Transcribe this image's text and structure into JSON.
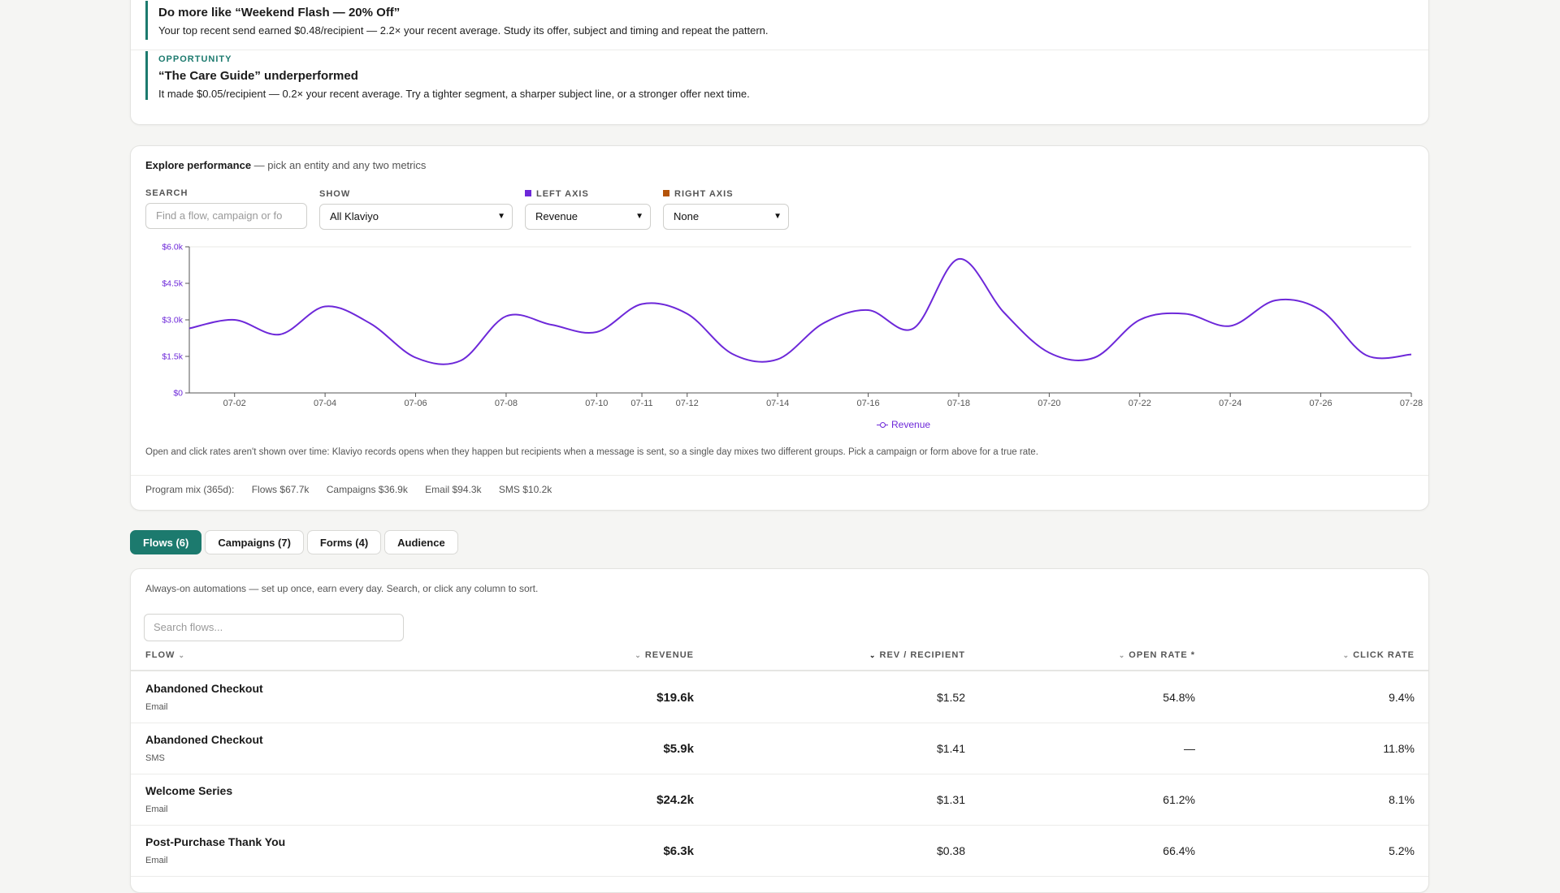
{
  "insights": [
    {
      "kicker": "",
      "title": "Do more like “Weekend Flash — 20% Off”",
      "body": "Your top recent send earned $0.48/recipient — 2.2× your recent average. Study its offer, subject and timing and repeat the pattern."
    },
    {
      "kicker": "OPPORTUNITY",
      "title": "“The Care Guide” underperformed",
      "body": "It made $0.05/recipient — 0.2× your recent average. Try a tighter segment, a sharper subject line, or a stronger offer next time."
    }
  ],
  "explore": {
    "title": "Explore performance",
    "subtitle": "— pick an entity and any two metrics",
    "search_label": "SEARCH",
    "search_placeholder": "Find a flow, campaign or fo",
    "show_label": "SHOW",
    "show_value": "All Klaviyo",
    "left_axis_label": "LEFT AXIS",
    "left_axis_value": "Revenue",
    "right_axis_label": "RIGHT AXIS",
    "right_axis_value": "None",
    "left_axis_color": "#6d28d9",
    "right_axis_color": "#b45309",
    "legend": "Revenue",
    "note": "Open and click rates aren't shown over time: Klaviyo records opens when they happen but recipients when a message is sent, so a single day mixes two different groups. Pick a campaign or form above for a true rate.",
    "mix": {
      "label": "Program mix (365d):",
      "flows": "Flows $67.7k",
      "campaigns": "Campaigns $36.9k",
      "email": "Email $94.3k",
      "sms": "SMS $10.2k"
    }
  },
  "chart_data": {
    "type": "line",
    "title": "",
    "xlabel": "",
    "ylabel": "",
    "ylim": [
      0,
      6000
    ],
    "yticks": [
      "$0",
      "$1.5k",
      "$3.0k",
      "$4.5k",
      "$6.0k"
    ],
    "xticks": [
      "07-02",
      "07-04",
      "07-06",
      "07-08",
      "07-10",
      "07-11",
      "07-12",
      "07-14",
      "07-16",
      "07-18",
      "07-20",
      "07-22",
      "07-24",
      "07-26",
      "07-28"
    ],
    "grid": "top line only",
    "legend_position": "bottom-center",
    "series": [
      {
        "name": "Revenue",
        "color": "#6d28d9",
        "x": [
          "07-01",
          "07-02",
          "07-03",
          "07-04",
          "07-05",
          "07-06",
          "07-07",
          "07-08",
          "07-09",
          "07-10",
          "07-11",
          "07-12",
          "07-13",
          "07-14",
          "07-15",
          "07-16",
          "07-17",
          "07-18",
          "07-19",
          "07-20",
          "07-21",
          "07-22",
          "07-23",
          "07-24",
          "07-25",
          "07-26",
          "07-27",
          "07-28"
        ],
        "values": [
          2650,
          3000,
          2400,
          3550,
          2850,
          1450,
          1330,
          3150,
          2800,
          2500,
          3650,
          3250,
          1600,
          1380,
          2850,
          3400,
          2650,
          5500,
          3300,
          1650,
          1450,
          3000,
          3250,
          2750,
          3800,
          3400,
          1550,
          1580
        ]
      }
    ]
  },
  "tabs": {
    "flows": "Flows (6)",
    "campaigns": "Campaigns (7)",
    "forms": "Forms (4)",
    "audience": "Audience"
  },
  "flows": {
    "description": "Always-on automations — set up once, earn every day. Search, or click any column to sort.",
    "search_placeholder": "Search flows...",
    "columns": {
      "flow": "FLOW",
      "revenue": "REVENUE",
      "rev_recipient": "REV / RECIPIENT",
      "open_rate": "OPEN RATE *",
      "click_rate": "CLICK RATE"
    },
    "rows": [
      {
        "name": "Abandoned Checkout",
        "channel": "Email",
        "revenue": "$19.6k",
        "rev_recipient": "$1.52",
        "open_rate": "54.8%",
        "click_rate": "9.4%"
      },
      {
        "name": "Abandoned Checkout",
        "channel": "SMS",
        "revenue": "$5.9k",
        "rev_recipient": "$1.41",
        "open_rate": "—",
        "click_rate": "11.8%"
      },
      {
        "name": "Welcome Series",
        "channel": "Email",
        "revenue": "$24.2k",
        "rev_recipient": "$1.31",
        "open_rate": "61.2%",
        "click_rate": "8.1%"
      },
      {
        "name": "Post-Purchase Thank You",
        "channel": "Email",
        "revenue": "$6.3k",
        "rev_recipient": "$0.38",
        "open_rate": "66.4%",
        "click_rate": "5.2%"
      }
    ]
  }
}
